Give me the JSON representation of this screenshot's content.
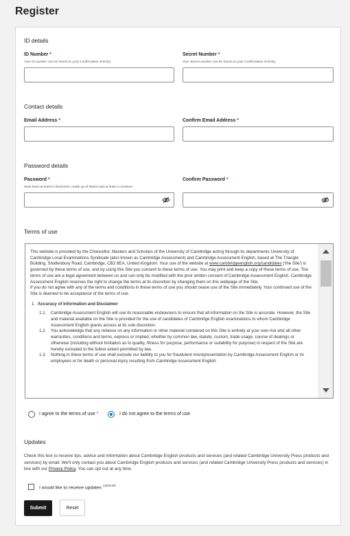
{
  "page": {
    "title": "Register"
  },
  "id_details": {
    "section_title": "ID details",
    "id_number": {
      "label": "ID Number",
      "hint_prefix": "Your ",
      "hint_em": "ID number",
      "hint_suffix": " can be found on your Confirmation of Entry.",
      "value": ""
    },
    "secret_number": {
      "label": "Secret Number",
      "hint_prefix": "Your ",
      "hint_em": "Secret number",
      "hint_suffix": " can be found on your Confirmation of Entry.",
      "value": ""
    }
  },
  "contact_details": {
    "section_title": "Contact details",
    "email": {
      "label": "Email Address",
      "value": ""
    },
    "confirm_email": {
      "label": "Confirm Email Address",
      "value": ""
    }
  },
  "password_details": {
    "section_title": "Password details",
    "password": {
      "label": "Password",
      "hint": "Must have at least 8 characters, made up of letters and at least 2 numbers.",
      "value": ""
    },
    "confirm_password": {
      "label": "Confirm Password",
      "value": ""
    }
  },
  "required_marker": "*",
  "terms": {
    "section_title": "Terms of use",
    "intro_1": "This website is provided by the Chancellor, Masters and Scholars of the University of Cambridge acting through its departments University of Cambridge Local Examinations Syndicate (also known as Cambridge Assessment) and Cambridge Assessment English, based at The Triangle Building, Shaftesbury Road, Cambridge, CB2 8EA, United Kingdom. Your use of the website at ",
    "intro_link": "www.cambridgeenglish.org/candidates",
    "intro_2": " ('the Site') is governed by these terms of use, and by using this Site you consent to these terms of use. You may print and keep a copy of these terms of use. The terms of use are a legal agreement between us and can only be modified with the prior written consent of Cambridge Assessment English. Cambridge Assessment English reserves the right to change the terms at its discretion by changing them on this webpage of the Site.",
    "intro_3": "If you do not agree with any of the terms and conditions in these terms of use you should cease use of the Site immediately. Your continued use of the Site is deemed to be acceptance of the terms of use.",
    "heading_num": "1.",
    "heading": "Accuracy of Information and Disclaimer",
    "clauses": [
      {
        "num": "1.1.",
        "text": "Cambridge Assessment English will use its reasonable endeavours to ensure that all information on the Site is accurate. However, the Site and material available on the Site is provided for the use of candidates of Cambridge English examinations to whom Cambridge Assessment English grants access at its sole discretion."
      },
      {
        "num": "1.2.",
        "text": "You acknowledge that any reliance on any information or other material contained on this Site is entirely at your own risk and all other warranties, conditions and terms, express or implied, whether by common law, statute, custom, trade usage, course of dealings or otherwise (including without limitation as to quality, fitness for purpose, performance or suitability for purpose) in respect of the Site are hereby excluded to the fullest extent permitted by law."
      },
      {
        "num": "1.3.",
        "text": "Nothing in these terms of use shall exclude our liability to you for fraudulent misrepresentation by Cambridge Assessment English or its employees or for death or personal injury resulting from Cambridge Assessment English"
      }
    ],
    "agree_label": "I agree to the terms of use",
    "disagree_label": "I do not agree to the terms of use",
    "selected": "disagree"
  },
  "updates": {
    "section_title": "Updates",
    "text_1": "Check this box to receive tips, advice and information about Cambridge English products and services (and related Cambridge University Press products and services) by email. We'll only contact you about Cambridge English products and services (and related Cambridge University Press products and services) in line with our ",
    "policy_link": "Privacy Policy",
    "text_2": ". You can opt out at any time.",
    "checkbox_label": "I would like to receive updates",
    "optional_tag": "(optional)",
    "checked": false
  },
  "actions": {
    "submit_label": "Submit",
    "reset_label": "Reset"
  },
  "colors": {
    "accent": "#0b6fa4",
    "required": "#c8102e",
    "submit_bg": "#1a1a1a"
  },
  "icons": {
    "password_toggle": "eye-slash-icon",
    "scroll_up": "arrow-up-icon",
    "scroll_down": "arrow-down-icon"
  }
}
